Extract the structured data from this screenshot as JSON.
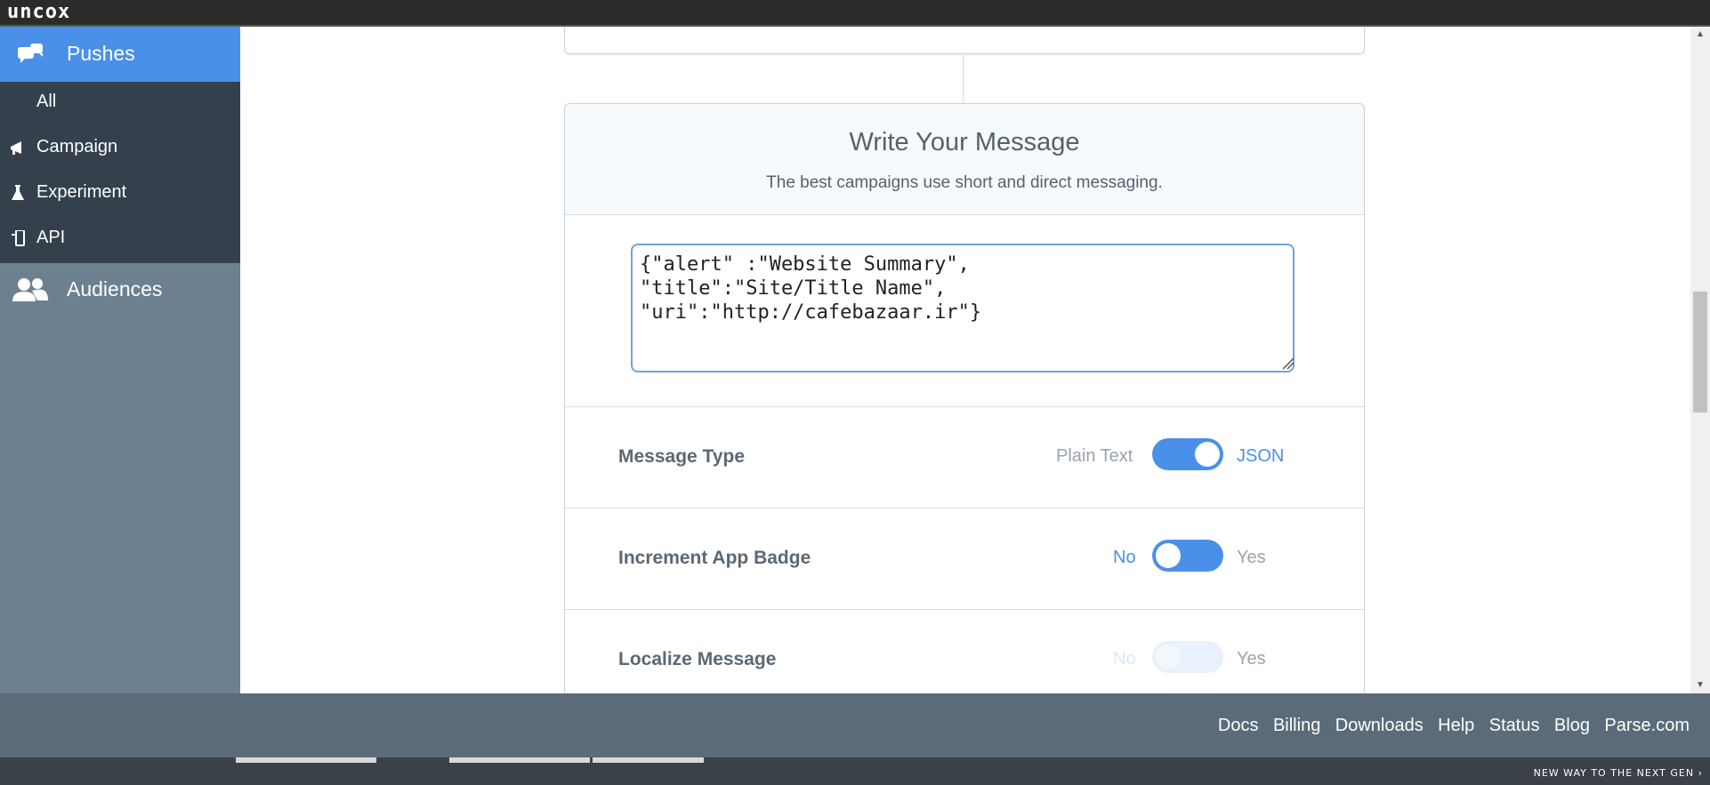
{
  "app": {
    "logo": "uncox"
  },
  "sidebar": {
    "pushes": "Pushes",
    "items": [
      {
        "label": "All",
        "icon": ""
      },
      {
        "label": "Campaign",
        "icon": "megaphone-icon"
      },
      {
        "label": "Experiment",
        "icon": "flask-icon"
      },
      {
        "label": "API",
        "icon": "phone-icon"
      }
    ],
    "audiences": "Audiences"
  },
  "card": {
    "title": "Write Your Message",
    "subtitle": "The best campaigns use short and direct messaging.",
    "message": "{\"alert\" :\"Website Summary\",\n\"title\":\"Site/Title Name\",\n\"uri\":\"http://cafebazaar.ir\"}"
  },
  "rows": {
    "message_type": {
      "label": "Message Type",
      "off": "Plain Text",
      "on": "JSON",
      "value": "JSON"
    },
    "increment_badge": {
      "label": "Increment App Badge",
      "off": "No",
      "on": "Yes",
      "value": "No"
    },
    "localize": {
      "label": "Localize Message",
      "off": "No",
      "on": "Yes",
      "value": "No",
      "disabled": true
    }
  },
  "footer": {
    "links": [
      "Docs",
      "Billing",
      "Downloads",
      "Help",
      "Status",
      "Blog",
      "Parse.com"
    ]
  },
  "taskbar": {
    "slogan": "NEW WAY TO THE NEXT GEN ›"
  },
  "colors": {
    "accent": "#4a90e8",
    "sidebar": "#6c808f",
    "sidebar_sub": "#34414d",
    "footer": "#5b6b79"
  }
}
